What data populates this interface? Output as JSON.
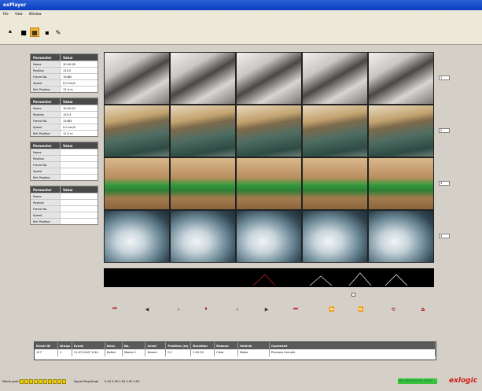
{
  "window": {
    "title": "exPlayer"
  },
  "menu": [
    "File",
    "View",
    "Window"
  ],
  "toolbar": [
    {
      "name": "open-icon",
      "glyph": "⯅"
    },
    {
      "name": "stop-icon",
      "glyph": "■"
    },
    {
      "name": "grid-view-icon",
      "glyph": "▦"
    },
    {
      "name": "single-view-icon",
      "glyph": "▪"
    },
    {
      "name": "tools-icon",
      "glyph": "✎"
    }
  ],
  "param_tables": [
    {
      "header": [
        "Parameter",
        "Value"
      ],
      "rows": [
        [
          "Name",
          "10:00:00"
        ],
        [
          "Position",
          "125.0"
        ],
        [
          "Frame No.",
          "15482"
        ],
        [
          "Speed",
          "0.0 km/h"
        ],
        [
          "Ref. Position",
          "12.4 m"
        ]
      ]
    },
    {
      "header": [
        "Parameter",
        "Value"
      ],
      "rows": [
        [
          "Name",
          "10:00:01"
        ],
        [
          "Position",
          "125.3"
        ],
        [
          "Frame No.",
          "15483"
        ],
        [
          "Speed",
          "0.0 km/h"
        ],
        [
          "Ref. Position",
          "12.5 m"
        ]
      ]
    },
    {
      "header": [
        "Parameter",
        "Value"
      ],
      "rows": [
        [
          "Name",
          ""
        ],
        [
          "Position",
          ""
        ],
        [
          "Frame No.",
          ""
        ],
        [
          "Speed",
          ""
        ],
        [
          "Ref. Position",
          ""
        ]
      ]
    },
    {
      "header": [
        "Parameter",
        "Value"
      ],
      "rows": [
        [
          "Name",
          ""
        ],
        [
          "Position",
          ""
        ],
        [
          "Frame No.",
          ""
        ],
        [
          "Speed",
          ""
        ],
        [
          "Ref. Position",
          ""
        ]
      ]
    }
  ],
  "camera_labels": [
    "1",
    "2",
    "3",
    "4"
  ],
  "playback": [
    {
      "name": "first-icon",
      "glyph": "⏮",
      "dark": false
    },
    {
      "name": "play-back-icon",
      "glyph": "◀",
      "dark": true
    },
    {
      "name": "step-back-icon",
      "glyph": "‹",
      "dark": true
    },
    {
      "name": "pause-icon",
      "glyph": "⏸",
      "dark": false
    },
    {
      "name": "step-forward-icon",
      "glyph": "›",
      "dark": true
    },
    {
      "name": "play-icon",
      "glyph": "▶",
      "dark": true
    },
    {
      "name": "last-icon",
      "glyph": "⏭",
      "dark": false
    },
    {
      "name": "prev-event-icon",
      "glyph": "⏪",
      "dark": false
    },
    {
      "name": "next-event-icon",
      "glyph": "⏩",
      "dark": false
    },
    {
      "name": "loop-icon",
      "glyph": "⟲",
      "dark": false
    },
    {
      "name": "end-icon",
      "glyph": "⏏",
      "dark": false
    }
  ],
  "events": {
    "header": [
      "Event ID",
      "Group",
      "Event",
      "Desc.",
      "No.",
      "Level",
      "Position (m)",
      "Duration",
      "Reason",
      "Vehicle",
      "Comment"
    ],
    "row": [
      "127",
      "1",
      "11:47:04:07 0.44",
      "Defect",
      "Sleeve 1",
      "Severe",
      "0.1",
      "1:02:32",
      "Clear",
      "Motor",
      "Previous Unmark"
    ]
  },
  "status": {
    "left_label": "Media position",
    "mid_label": "Signal Magnitude",
    "mid_value": "0.00 0.00 0.00 0.00 0.00",
    "recording": "Rec 00:00:00 0%, 00:00",
    "logo": "exlogic"
  }
}
